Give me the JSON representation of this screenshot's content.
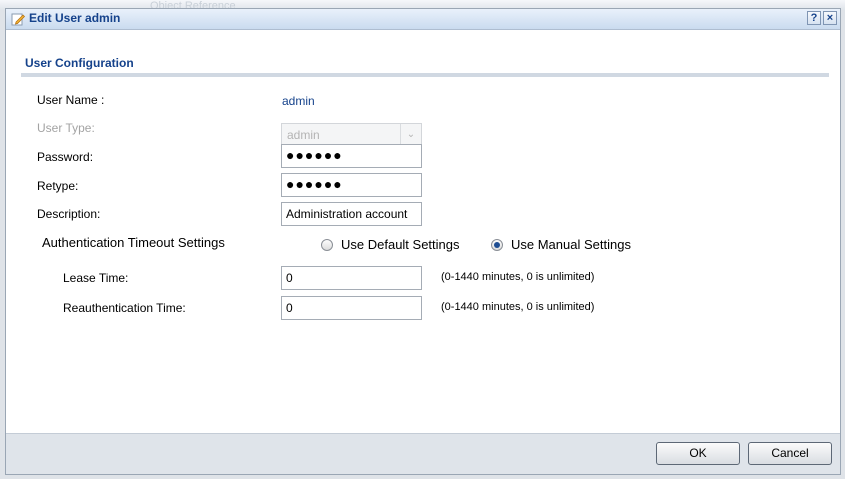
{
  "background": {
    "ghost_text": "Object Reference"
  },
  "dialog": {
    "title": "Edit User admin",
    "help_glyph": "?",
    "close_glyph": "×"
  },
  "section": {
    "title": "User Configuration"
  },
  "form": {
    "user_name": {
      "label": "User Name :",
      "value": "admin"
    },
    "user_type": {
      "label": "User Type:",
      "value": "admin"
    },
    "password": {
      "label": "Password:",
      "value": "●●●●●●"
    },
    "retype": {
      "label": "Retype:",
      "value": "●●●●●●"
    },
    "description": {
      "label": "Description:",
      "value": "Administration account"
    },
    "auth_timeout": {
      "label": "Authentication Timeout Settings",
      "options": [
        {
          "label": "Use Default Settings",
          "checked": false
        },
        {
          "label": "Use Manual Settings",
          "checked": true
        }
      ]
    },
    "lease_time": {
      "label": "Lease Time:",
      "value": "0",
      "hint": "(0-1440 minutes, 0 is unlimited)"
    },
    "reauth_time": {
      "label": "Reauthentication Time:",
      "value": "0",
      "hint": "(0-1440 minutes, 0 is unlimited)"
    }
  },
  "buttons": {
    "ok": "OK",
    "cancel": "Cancel"
  },
  "colors": {
    "accent": "#15428b",
    "radio_dot": "#1e4d92"
  },
  "icons": {
    "title": "edit-pencil-icon",
    "dropdown": "chevron-down-icon"
  }
}
